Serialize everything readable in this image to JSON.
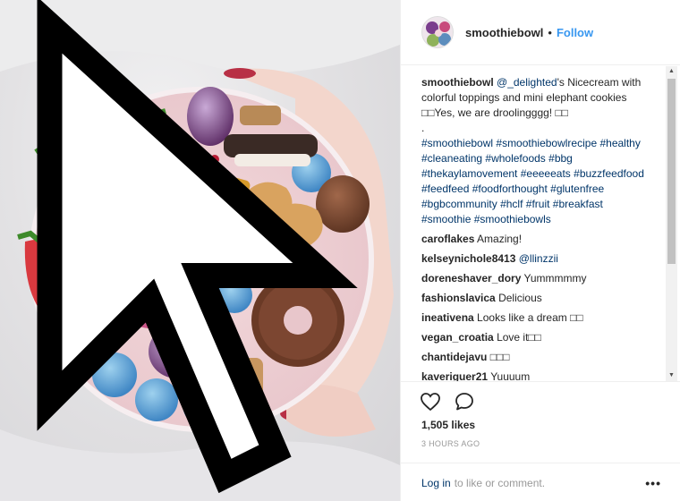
{
  "post": {
    "author": "smoothiebowl",
    "separator": "•",
    "follow_label": "Follow"
  },
  "caption": {
    "author": "smoothiebowl",
    "mention": "@_delighted",
    "text": "'s Nicecream with colorful toppings and mini elephant cookies □□Yes, we are droolingggg! □□",
    "dot": ".",
    "hashtags": [
      "#smoothiebowl",
      "#smoothiebowlrecipe",
      "#healthy",
      "#cleaneating",
      "#wholefoods",
      "#bbg",
      "#thekaylamovement",
      "#eeeeeats",
      "#buzzfeedfood",
      "#feedfeed",
      "#foodforthought",
      "#glutenfree",
      "#bgbcommunity",
      "#hclf",
      "#fruit",
      "#breakfast",
      "#smoothie",
      "#smoothiebowls"
    ]
  },
  "comments": [
    {
      "user": "caroflakes",
      "text": "Amazing!"
    },
    {
      "user": "kelseynichole8413",
      "text": "@llinzzii"
    },
    {
      "user": "doreneshaver_dory",
      "text": "Yummmmmy"
    },
    {
      "user": "fashionslavica",
      "text": "Delicious"
    },
    {
      "user": "ineativena",
      "text": "Looks like a dream □□"
    },
    {
      "user": "vegan_croatia",
      "text": "Love it□□"
    },
    {
      "user": "chantidejavu",
      "text": "□□□"
    },
    {
      "user": "kaveriguer21",
      "text": "Yuuuum"
    }
  ],
  "stats": {
    "likes": "1,505 likes",
    "time": "3 HOURS AGO"
  },
  "login": {
    "link": "Log in",
    "text": "to like or comment.",
    "more": "•••"
  },
  "icons": {
    "like": "heart-icon",
    "comment": "comment-bubble-icon",
    "more": "more-options-icon"
  }
}
